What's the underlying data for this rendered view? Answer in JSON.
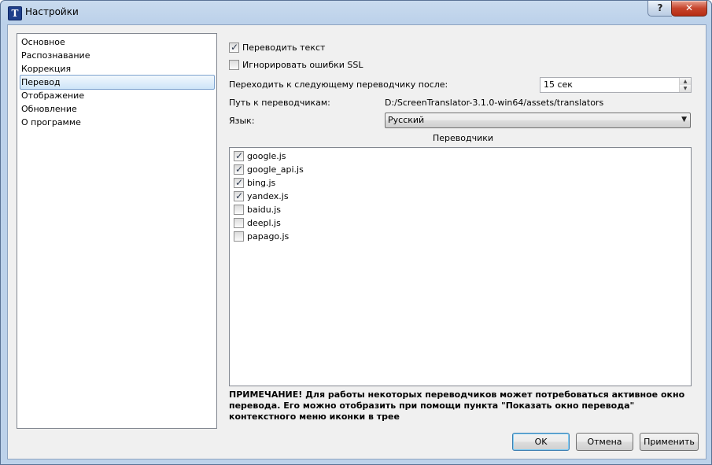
{
  "window": {
    "title": "Настройки",
    "help_label": "?",
    "close_label": "✕"
  },
  "sidebar": {
    "items": [
      {
        "label": "Основное"
      },
      {
        "label": "Распознавание"
      },
      {
        "label": "Коррекция"
      },
      {
        "label": "Перевод",
        "selected": true
      },
      {
        "label": "Отображение"
      },
      {
        "label": "Обновление"
      },
      {
        "label": "О программе"
      }
    ]
  },
  "translate": {
    "translate_text": {
      "label": "Переводить текст",
      "checked": true
    },
    "ignore_ssl": {
      "label": "Игнорировать ошибки SSL",
      "checked": false
    },
    "switch_after_label": "Переходить к следующему переводчику после:",
    "switch_after_value": "15 сек",
    "path_label": "Путь к переводчикам:",
    "path_value": "D:/ScreenTranslator-3.1.0-win64/assets/translators",
    "language_label": "Язык:",
    "language_value": "Русский",
    "translators_header": "Переводчики",
    "translators": [
      {
        "name": "google.js",
        "checked": true
      },
      {
        "name": "google_api.js",
        "checked": true
      },
      {
        "name": "bing.js",
        "checked": true
      },
      {
        "name": "yandex.js",
        "checked": true
      },
      {
        "name": "baidu.js",
        "checked": false
      },
      {
        "name": "deepl.js",
        "checked": false
      },
      {
        "name": "papago.js",
        "checked": false
      }
    ],
    "note": "ПРИМЕЧАНИЕ! Для работы некоторых переводчиков может потребоваться активное окно перевода. Его можно отобразить при помощи пункта \"Показать окно перевода\" контекстного меню иконки в трее"
  },
  "buttons": {
    "ok": "OK",
    "cancel": "Отмена",
    "apply": "Применить"
  }
}
